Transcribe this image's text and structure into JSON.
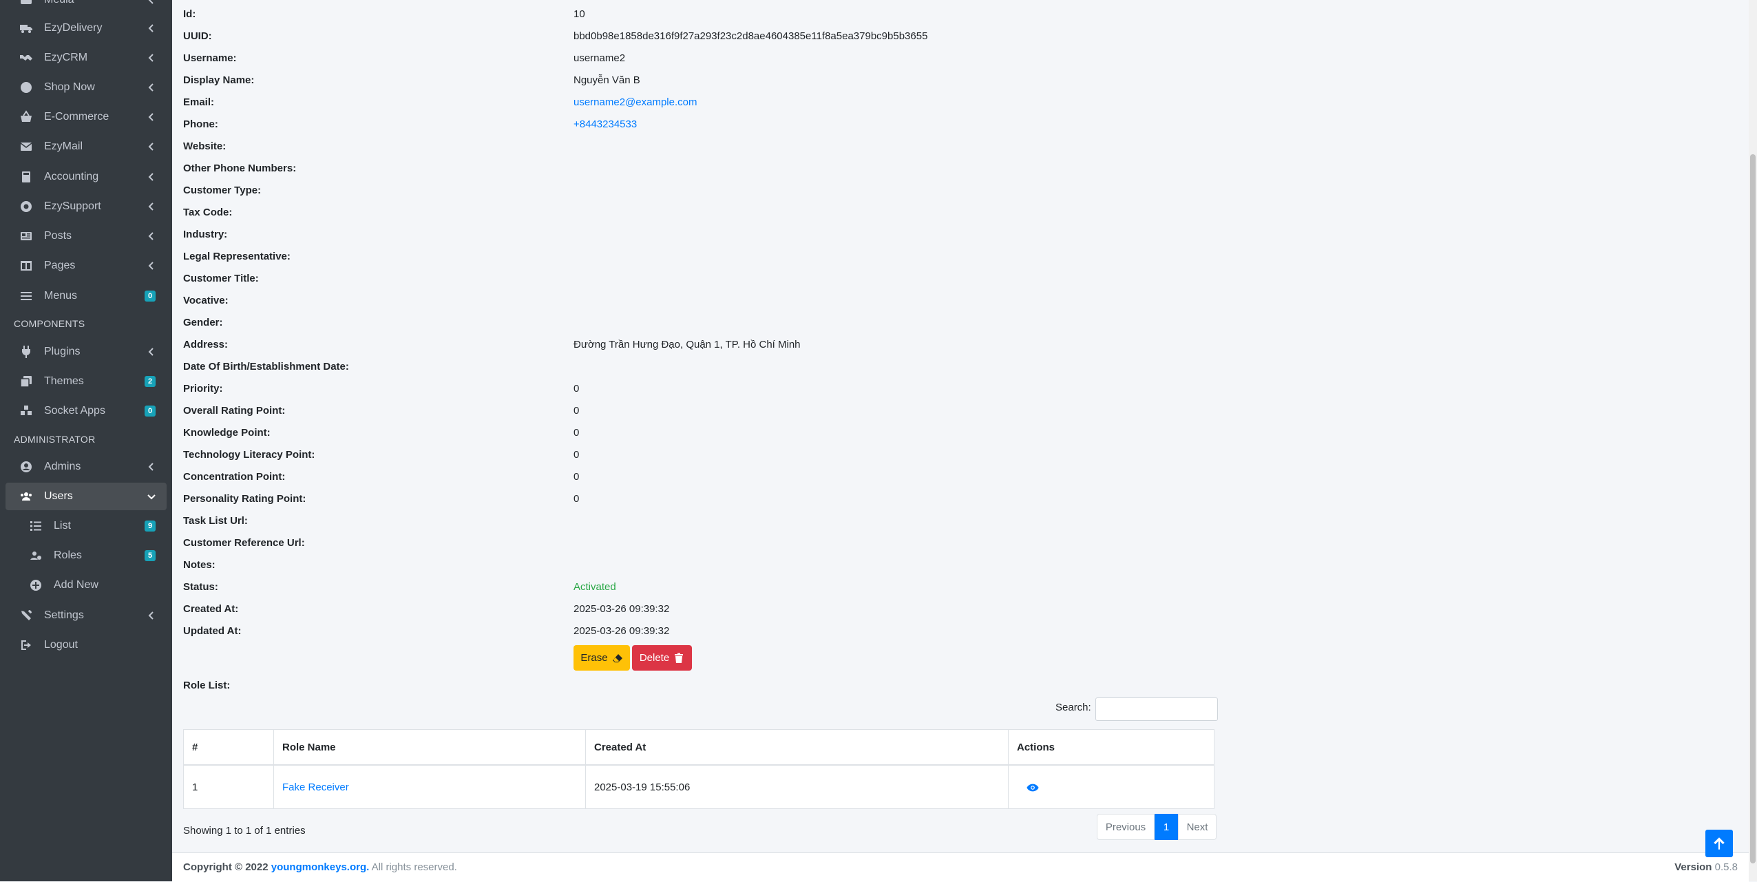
{
  "sidebar": {
    "items": [
      {
        "label": "Media"
      },
      {
        "label": "EzyDelivery"
      },
      {
        "label": "EzyCRM"
      },
      {
        "label": "Shop Now"
      },
      {
        "label": "E-Commerce"
      },
      {
        "label": "EzyMail"
      },
      {
        "label": "Accounting"
      },
      {
        "label": "EzySupport"
      },
      {
        "label": "Posts"
      },
      {
        "label": "Pages"
      },
      {
        "label": "Menus",
        "badge": "0"
      },
      {
        "label": "Plugins"
      },
      {
        "label": "Themes",
        "badge": "2"
      },
      {
        "label": "Socket Apps",
        "badge": "0"
      },
      {
        "label": "Admins"
      },
      {
        "label": "Users"
      },
      {
        "label": "List",
        "badge": "9"
      },
      {
        "label": "Roles",
        "badge": "5"
      },
      {
        "label": "Add New"
      },
      {
        "label": "Settings"
      },
      {
        "label": "Logout"
      }
    ],
    "headers": {
      "components": "COMPONENTS",
      "administrator": "ADMINISTRATOR"
    }
  },
  "details": [
    {
      "label": "Id:",
      "value": "10"
    },
    {
      "label": "UUID:",
      "value": "bbd0b98e1858de316f9f27a293f23c2d8ae4604385e11f8a5ea379bc9b5b3655"
    },
    {
      "label": "Username:",
      "value": "username2"
    },
    {
      "label": "Display Name:",
      "value": "Nguyễn Văn B"
    },
    {
      "label": "Email:",
      "value": "username2@example.com"
    },
    {
      "label": "Phone:",
      "value": "+8443234533"
    },
    {
      "label": "Website:",
      "value": ""
    },
    {
      "label": "Other Phone Numbers:",
      "value": ""
    },
    {
      "label": "Customer Type:",
      "value": ""
    },
    {
      "label": "Tax Code:",
      "value": ""
    },
    {
      "label": "Industry:",
      "value": ""
    },
    {
      "label": "Legal Representative:",
      "value": ""
    },
    {
      "label": "Customer Title:",
      "value": ""
    },
    {
      "label": "Vocative:",
      "value": ""
    },
    {
      "label": "Gender:",
      "value": ""
    },
    {
      "label": "Address:",
      "value": "Đường Trần Hưng Đạo, Quận 1, TP. Hồ Chí Minh"
    },
    {
      "label": "Date Of Birth/Establishment Date:",
      "value": ""
    },
    {
      "label": "Priority:",
      "value": "0"
    },
    {
      "label": "Overall Rating Point:",
      "value": "0"
    },
    {
      "label": "Knowledge Point:",
      "value": "0"
    },
    {
      "label": "Technology Literacy Point:",
      "value": "0"
    },
    {
      "label": "Concentration Point:",
      "value": "0"
    },
    {
      "label": "Personality Rating Point:",
      "value": "0"
    },
    {
      "label": "Task List Url:",
      "value": ""
    },
    {
      "label": "Customer Reference Url:",
      "value": ""
    },
    {
      "label": "Notes:",
      "value": ""
    },
    {
      "label": "Status:",
      "value": "Activated"
    },
    {
      "label": "Created At:",
      "value": "2025-03-26 09:39:32"
    },
    {
      "label": "Updated At:",
      "value": "2025-03-26 09:39:32"
    }
  ],
  "actions": {
    "erase": "Erase",
    "delete": "Delete"
  },
  "role_list": {
    "title": "Role List:",
    "search_label": "Search:",
    "columns": [
      "#",
      "Role Name",
      "Created At",
      "Actions"
    ],
    "rows": [
      {
        "num": "1",
        "name": "Fake Receiver",
        "created": "2025-03-19 15:55:06"
      }
    ],
    "showing": "Showing 1 to 1 of 1 entries",
    "pager": {
      "prev": "Previous",
      "page": "1",
      "next": "Next"
    }
  },
  "footer": {
    "copyright_prefix": "Copyright © 2022",
    "site": "youngmonkeys.org.",
    "rights": "All rights reserved.",
    "version_label": "Version",
    "version": "0.5.8"
  },
  "colors": {
    "sidebar": "#343a40",
    "primary": "#007bff",
    "warning": "#ffc107",
    "danger": "#dc3545",
    "success": "#28a745",
    "badge": "#17a2b8"
  }
}
